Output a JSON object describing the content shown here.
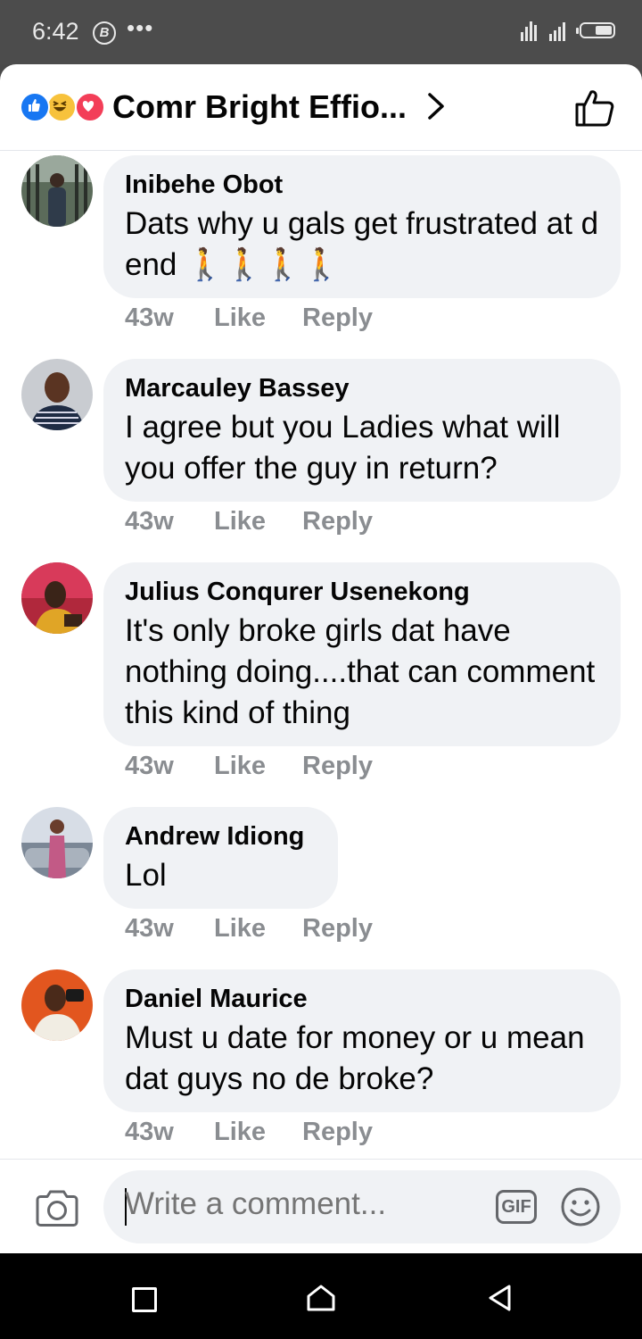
{
  "status_bar": {
    "time": "6:42",
    "b_badge": "B",
    "dots": "•••"
  },
  "header": {
    "title": "Comr Bright Effio...",
    "reaction_icons": [
      "like-reaction-icon",
      "haha-reaction-icon",
      "love-reaction-icon"
    ],
    "colors": {
      "like": "#1877f2",
      "haha": "#f7c23c",
      "love": "#f33e58"
    }
  },
  "comments": [
    {
      "name": "Inibehe Obot",
      "text": "Dats why u gals get frustrated at d end 🚶🚶🚶🚶",
      "time": "43w",
      "like": "Like",
      "reply": "Reply"
    },
    {
      "name": "Marcauley Bassey",
      "text": "I agree but you Ladies what will you offer the guy in return?",
      "time": "43w",
      "like": "Like",
      "reply": "Reply"
    },
    {
      "name": "Julius Conqurer Usenekong",
      "text": "It's only broke girls dat have nothing doing....that can comment this kind of thing",
      "time": "43w",
      "like": "Like",
      "reply": "Reply"
    },
    {
      "name": "Andrew Idiong",
      "text": "Lol",
      "time": "43w",
      "like": "Like",
      "reply": "Reply"
    },
    {
      "name": "Daniel Maurice",
      "text": "Must u date for money or u mean dat guys no de broke?",
      "time": "43w",
      "like": "Like",
      "reply": "Reply"
    }
  ],
  "composer": {
    "placeholder": "Write a comment...",
    "gif_label": "GIF"
  }
}
